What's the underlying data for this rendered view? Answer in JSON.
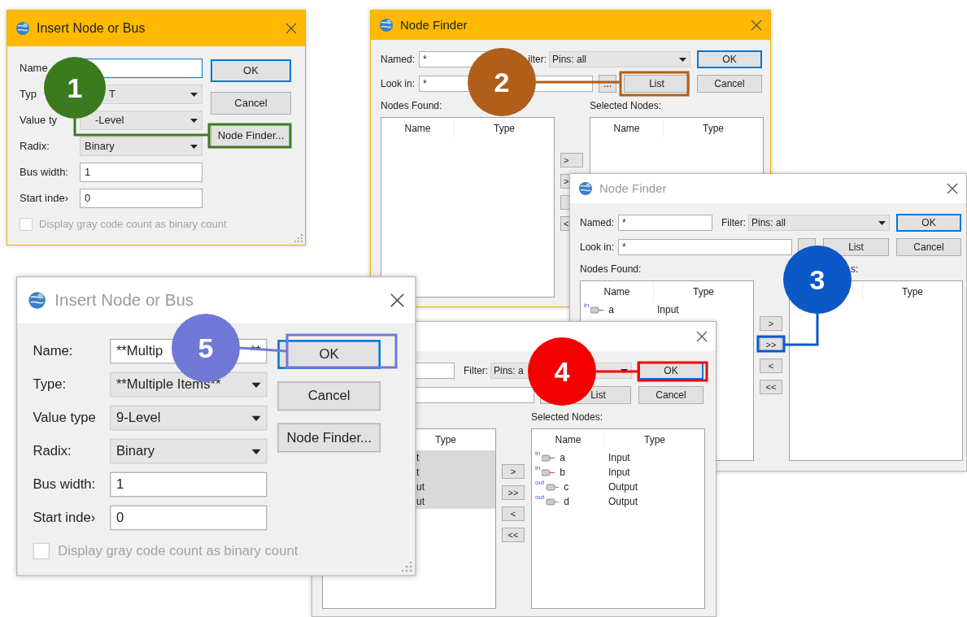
{
  "windows": [
    {
      "kind": "insert",
      "title": "Insert Node or Bus",
      "active": true,
      "fields": [
        {
          "label": "Name",
          "kind": "text",
          "focused": true
        },
        {
          "label": "Typ",
          "kind": "select",
          "value": "T"
        },
        {
          "label": "Value ty",
          "kind": "select",
          "value": "-Level"
        },
        {
          "label": "Radix:",
          "kind": "select",
          "value": "Binary"
        },
        {
          "label": "Bus width:",
          "kind": "text",
          "value": "1",
          "focused": false
        },
        {
          "label": "Start inde›",
          "kind": "text",
          "value": "0",
          "focused": false
        }
      ],
      "buttons": [
        {
          "label": "OK",
          "default": true
        },
        {
          "label": "Cancel",
          "default": false
        },
        {
          "label": "Node Finder...",
          "default": false
        }
      ],
      "checkbox": {
        "label": "Display gray code count as binary count",
        "checked": false,
        "disabled": true
      }
    },
    {
      "kind": "finder",
      "title": "Node Finder",
      "active": true,
      "named": {
        "label": "Named:",
        "value": "*"
      },
      "filter": {
        "label": "ilter:",
        "value": "Pins: all"
      },
      "look_in": {
        "label": "Look in:",
        "value": "*"
      },
      "browse": {
        "label": "..."
      },
      "buttons": [
        {
          "label": "OK",
          "default": true
        },
        {
          "label": "List",
          "default": false
        },
        {
          "label": "Cancel",
          "default": false
        }
      ],
      "found": {
        "label": "Nodes Found:",
        "name_header": "Name",
        "type_header": "Type"
      },
      "selected": {
        "label": "Selected Nodes:",
        "name_header": "Name",
        "type_header": "Type"
      },
      "moves": [
        {
          "kind": "button",
          "label": ">"
        },
        {
          "kind": "button",
          "label": ">"
        },
        {
          "kind": "blank"
        },
        {
          "kind": "button",
          "label": "<"
        }
      ]
    },
    {
      "kind": "finder",
      "title": "Node Finder",
      "active": false,
      "named": {
        "label": "Named:",
        "value": "*"
      },
      "filter": {
        "label": "Filter:",
        "value": "Pins: all"
      },
      "look_in": {
        "label": "Look in:",
        "value": "*"
      },
      "buttons": [
        {
          "label": "OK",
          "default": true
        },
        {
          "label": "List",
          "default": false
        },
        {
          "label": "Cancel",
          "default": false
        }
      ],
      "found": {
        "label": "Nodes Found:",
        "name_header": "Name",
        "type_header": "Type",
        "rows": [
          {
            "pin": "in",
            "name": "a",
            "type": "Input",
            "selected": false
          }
        ]
      },
      "selected": {
        "label": "s:",
        "type_header": "Type"
      },
      "moves": [
        {
          "kind": "button",
          "label": ">"
        },
        {
          "kind": "button",
          "label": ">>"
        },
        {
          "kind": "button",
          "label": "<"
        },
        {
          "kind": "button",
          "label": "<<"
        }
      ]
    },
    {
      "kind": "finder",
      "active": false,
      "filter": {
        "label": "Filter:",
        "value": "Pins: a"
      },
      "buttons": [
        {
          "label": "OK",
          "default": true
        },
        {
          "label": "List",
          "default": false
        },
        {
          "label": "Cancel",
          "default": false
        }
      ],
      "found": {
        "type_header": "Type",
        "rows": [
          {
            "type": "t",
            "selected": true
          },
          {
            "type": "t",
            "selected": true
          },
          {
            "type": "ut",
            "selected": true
          },
          {
            "type": "ut",
            "selected": true
          }
        ]
      },
      "selected": {
        "label": "Selected Nodes:",
        "name_header": "Name",
        "type_header": "Type",
        "rows": [
          {
            "pin": "in",
            "name": "a",
            "type": "Input",
            "selected": false
          },
          {
            "pin": "in",
            "name": "b",
            "type": "Input",
            "selected": false
          },
          {
            "pin": "out",
            "name": "c",
            "type": "Output",
            "selected": false
          },
          {
            "pin": "out",
            "name": "d",
            "type": "Output",
            "selected": false
          }
        ]
      },
      "moves": [
        {
          "kind": "button",
          "label": ">"
        },
        {
          "kind": "button",
          "label": ">>"
        },
        {
          "kind": "button",
          "label": "<"
        },
        {
          "kind": "button",
          "label": "<<"
        }
      ]
    },
    {
      "kind": "insert",
      "title": "Insert Node or Bus",
      "active": false,
      "fields": [
        {
          "label": "Name:",
          "kind": "text",
          "value": "**Multip",
          "value_tail": "**",
          "focused": false
        },
        {
          "label": "Type:",
          "kind": "select",
          "value": "**Multiple Items**"
        },
        {
          "label": "Value type",
          "kind": "select",
          "value": "9-Level"
        },
        {
          "label": "Radix:",
          "kind": "select",
          "value": "Binary"
        },
        {
          "label": "Bus width:",
          "kind": "text",
          "value": "1",
          "focused": false
        },
        {
          "label": "Start inde›",
          "kind": "text",
          "value": "0",
          "focused": false
        }
      ],
      "buttons": [
        {
          "label": "OK",
          "default": true
        },
        {
          "label": "Cancel",
          "default": false
        },
        {
          "label": "Node Finder...",
          "default": false
        }
      ],
      "checkbox": {
        "label": "Display gray code count as binary count",
        "checked": false,
        "disabled": true
      }
    }
  ],
  "callouts": [
    {
      "number": "1",
      "color": "#3b7a1f"
    },
    {
      "number": "2",
      "color": "#b05f1a"
    },
    {
      "number": "3",
      "color": "#0c58c6"
    },
    {
      "number": "4",
      "color": "#f50000"
    },
    {
      "number": "5",
      "color": "#7078d6"
    }
  ]
}
